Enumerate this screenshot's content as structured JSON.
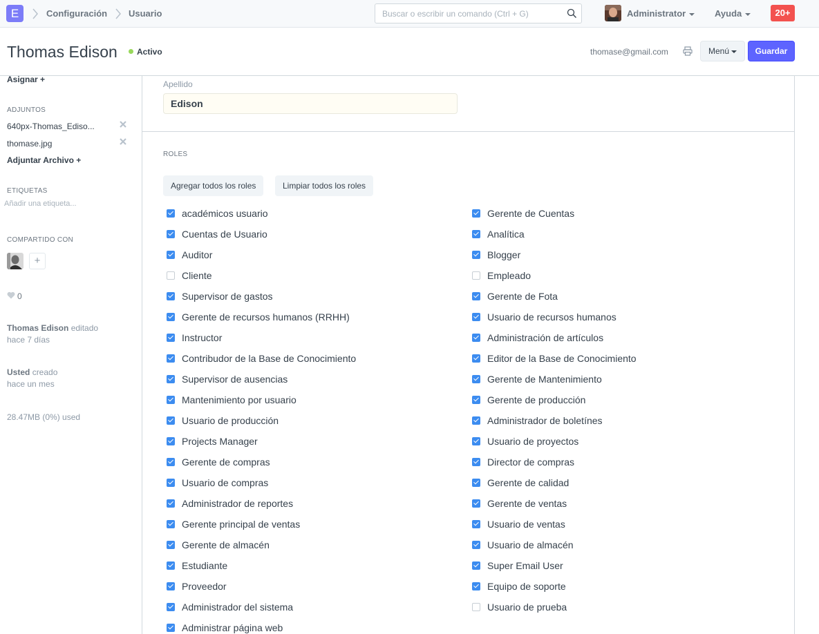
{
  "navbar": {
    "logo_letter": "E",
    "breadcrumbs": [
      "Configuración",
      "Usuario"
    ],
    "search_placeholder": "Buscar o escribir un comando (Ctrl + G)",
    "user_name": "Administrator",
    "help_label": "Ayuda",
    "notification_count": "20+"
  },
  "page": {
    "title": "Thomas Edison",
    "status": "Activo",
    "email": "thomase@gmail.com",
    "menu_label": "Menú",
    "save_label": "Guardar"
  },
  "sidebar": {
    "assign_label": "Asignar +",
    "attachments_heading": "ADJUNTOS",
    "attachments": [
      "640px-Thomas_Ediso...",
      "thomase.jpg"
    ],
    "attach_file_label": "Adjuntar Archivo +",
    "tags_heading": "ETIQUETAS",
    "add_tag_placeholder": "Añadir una etiqueta...",
    "shared_heading": "COMPARTIDO CON",
    "share_add": "+",
    "likes_count": "0",
    "activity": [
      {
        "user": "Thomas Edison",
        "action": "editado",
        "when": "hace 7 días"
      },
      {
        "user": "Usted",
        "action": "creado",
        "when": "hace un mes"
      }
    ],
    "storage": "28.47MB (0%) used"
  },
  "form": {
    "last_name_label": "Apellido",
    "last_name_value": "Edison",
    "roles_heading": "ROLES",
    "add_all_label": "Agregar todos los roles",
    "clear_all_label": "Limpiar todos los roles",
    "roles_left": [
      {
        "label": "académicos usuario",
        "checked": true
      },
      {
        "label": "Cuentas de Usuario",
        "checked": true
      },
      {
        "label": "Auditor",
        "checked": true
      },
      {
        "label": "Cliente",
        "checked": false
      },
      {
        "label": "Supervisor de gastos",
        "checked": true
      },
      {
        "label": "Gerente de recursos humanos (RRHH)",
        "checked": true
      },
      {
        "label": "Instructor",
        "checked": true
      },
      {
        "label": "Contribudor de la Base de Conocimiento",
        "checked": true
      },
      {
        "label": "Supervisor de ausencias",
        "checked": true
      },
      {
        "label": "Mantenimiento por usuario",
        "checked": true
      },
      {
        "label": "Usuario de producción",
        "checked": true
      },
      {
        "label": "Projects Manager",
        "checked": true
      },
      {
        "label": "Gerente de compras",
        "checked": true
      },
      {
        "label": "Usuario de compras",
        "checked": true
      },
      {
        "label": "Administrador de reportes",
        "checked": true
      },
      {
        "label": "Gerente principal de ventas",
        "checked": true
      },
      {
        "label": "Gerente de almacén",
        "checked": true
      },
      {
        "label": "Estudiante",
        "checked": true
      },
      {
        "label": "Proveedor",
        "checked": true
      },
      {
        "label": "Administrador del sistema",
        "checked": true
      },
      {
        "label": "Administrar página web",
        "checked": true
      }
    ],
    "roles_right": [
      {
        "label": "Gerente de Cuentas",
        "checked": true
      },
      {
        "label": "Analítica",
        "checked": true
      },
      {
        "label": "Blogger",
        "checked": true
      },
      {
        "label": "Empleado",
        "checked": false
      },
      {
        "label": "Gerente de Fota",
        "checked": true
      },
      {
        "label": "Usuario de recursos humanos",
        "checked": true
      },
      {
        "label": "Administración de artículos",
        "checked": true
      },
      {
        "label": "Editor de la Base de Conocimiento",
        "checked": true
      },
      {
        "label": "Gerente de Mantenimiento",
        "checked": true
      },
      {
        "label": "Gerente de producción",
        "checked": true
      },
      {
        "label": "Administrador de boletínes",
        "checked": true
      },
      {
        "label": "Usuario de proyectos",
        "checked": true
      },
      {
        "label": "Director de compras",
        "checked": true
      },
      {
        "label": "Gerente de calidad",
        "checked": true
      },
      {
        "label": "Gerente de ventas",
        "checked": true
      },
      {
        "label": "Usuario de ventas",
        "checked": true
      },
      {
        "label": "Usuario de almacén",
        "checked": true
      },
      {
        "label": "Super Email User",
        "checked": true
      },
      {
        "label": "Equipo de soporte",
        "checked": true
      },
      {
        "label": "Usuario de prueba",
        "checked": false
      }
    ]
  },
  "colors": {
    "primary": "#5e64ff",
    "checkbox": "#3c8cf0",
    "status_active": "#98d85b",
    "notification": "#f3524f"
  }
}
